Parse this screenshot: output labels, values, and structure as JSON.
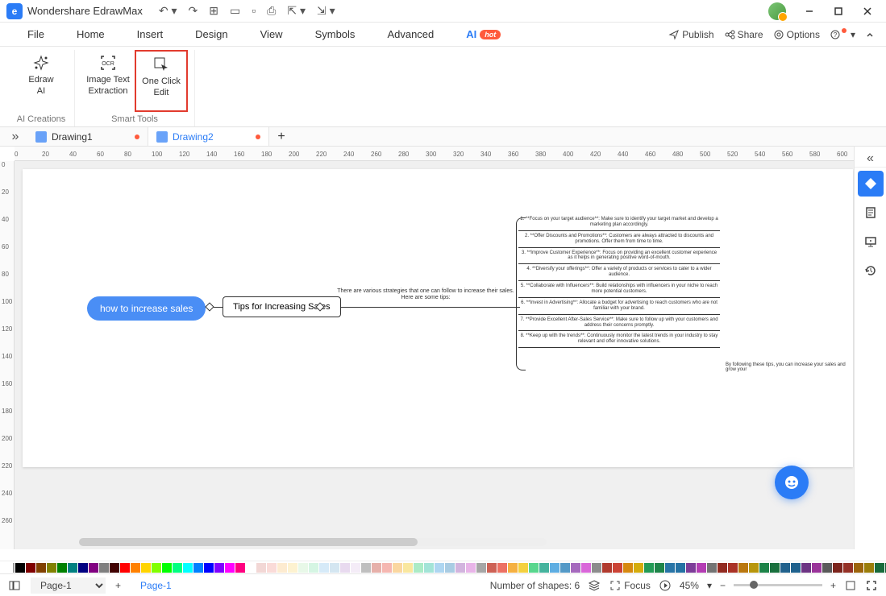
{
  "app": {
    "title": "Wondershare EdrawMax"
  },
  "menu": {
    "items": [
      "File",
      "Home",
      "Insert",
      "Design",
      "View",
      "Symbols",
      "Advanced"
    ],
    "ai": "AI",
    "hot": "hot",
    "publish": "Publish",
    "share": "Share",
    "options": "Options"
  },
  "ribbon": {
    "edraw_ai": "Edraw\nAI",
    "image_text": "Image Text\nExtraction",
    "one_click": "One Click\nEdit",
    "group_ai": "AI Creations",
    "group_smart": "Smart Tools"
  },
  "docs": {
    "d1": "Drawing1",
    "d2": "Drawing2"
  },
  "mindmap": {
    "root": "how to increase sales",
    "sub": "Tips for Increasing Sales",
    "mid": "There are various strategies that one can follow to increase their sales. Here are some tips:",
    "tips": [
      "1. **Focus on your target audience**: Make sure to identify your target market and develop a marketing plan accordingly.",
      "2. **Offer Discounts and Promotions**: Customers are always attracted to discounts and promotions. Offer them from time to time.",
      "3. **Improve Customer Experience**: Focus on providing an excellent customer experience as it helps in generating positive word-of-mouth.",
      "4. **Diversify your offerings**: Offer a variety of products or services to cater to a wider audience.",
      "5. **Collaborate with Influencers**: Build relationships with influencers in your niche to reach more potential customers.",
      "6. **Invest in Advertising**: Allocate a budget for advertising to reach customers who are not familiar with your brand.",
      "7. **Provide Excellent After-Sales Service**: Make sure to follow up with your customers and address their concerns promptly.",
      "8. **Keep up with the trends**: Continuously monitor the latest trends in your industry to stay relevant and offer innovative solutions."
    ],
    "follow": "By following these tips, you can increase your sales and grow your"
  },
  "status": {
    "page_sel": "Page-1",
    "page_tab": "Page-1",
    "shapes_label": "Number of shapes:",
    "shapes_count": "6",
    "focus": "Focus",
    "zoom": "45%"
  },
  "ruler": {
    "h": [
      "0",
      "20",
      "40",
      "60",
      "80",
      "100",
      "120",
      "140",
      "160",
      "180",
      "200",
      "220",
      "240",
      "260",
      "280",
      "300",
      "320",
      "340",
      "360",
      "380",
      "400",
      "420",
      "440",
      "460",
      "480",
      "500",
      "520",
      "540",
      "560",
      "580",
      "600"
    ],
    "v": [
      "0",
      "20",
      "40",
      "60",
      "80",
      "100",
      "120",
      "140",
      "160",
      "180",
      "200",
      "220",
      "240",
      "260"
    ]
  },
  "palette": [
    "#000000",
    "#7f0000",
    "#804000",
    "#808000",
    "#008000",
    "#008080",
    "#000080",
    "#800080",
    "#7f7f7f",
    "#400000",
    "#ff0000",
    "#ff8000",
    "#ffd400",
    "#80ff00",
    "#00ff00",
    "#00ff80",
    "#00ffff",
    "#0080ff",
    "#0000ff",
    "#8000ff",
    "#ff00ff",
    "#ff0080",
    "#ffffff",
    "#f2d7d5",
    "#fadbd8",
    "#fdebd0",
    "#fdf2d0",
    "#e8f8e8",
    "#d5f5e3",
    "#d6eaf8",
    "#d4e6f1",
    "#e8daef",
    "#f4ecf7",
    "#bfbfbf",
    "#e6b0aa",
    "#f5b7b1",
    "#fad7a0",
    "#f9e79f",
    "#abebc6",
    "#a3e4d7",
    "#aed6f1",
    "#a9cce3",
    "#d2b4de",
    "#e8b4e8",
    "#a6a6a6",
    "#cd6155",
    "#ec7063",
    "#f5b041",
    "#f4d03f",
    "#58d68d",
    "#45b39d",
    "#5dade2",
    "#5499c7",
    "#a569bd",
    "#d966d9",
    "#8c8c8c",
    "#b03a2e",
    "#cb4335",
    "#d68910",
    "#d4ac0d",
    "#239b56",
    "#1e8449",
    "#2874a6",
    "#2471a3",
    "#7d3c98",
    "#b33cb3",
    "#737373",
    "#922b21",
    "#a93226",
    "#b9770e",
    "#b7950b",
    "#1d8348",
    "#196f3d",
    "#21618c",
    "#1f618d",
    "#6c3483",
    "#993399",
    "#595959",
    "#7b241c",
    "#943126",
    "#9c640c",
    "#9a7d0a",
    "#186a3b",
    "#145a32",
    "#1a5276",
    "#1a5490",
    "#5b2c6f",
    "#803380"
  ]
}
